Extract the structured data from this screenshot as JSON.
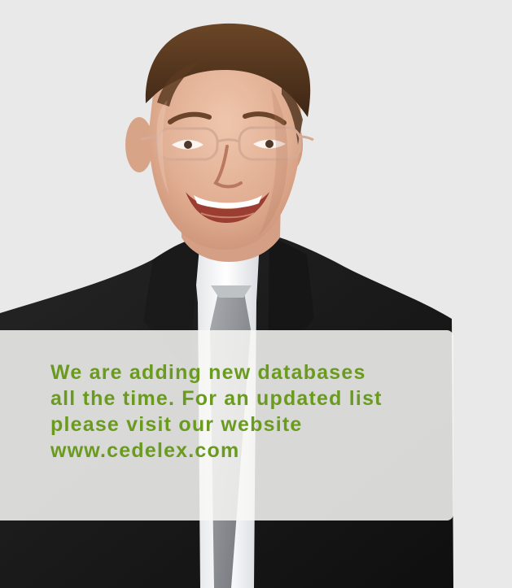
{
  "message": {
    "text": "We are adding new databases\nall the time. For an updated list\nplease visit our website\nwww.cedelex.com"
  },
  "colors": {
    "page_background": "#e9e9e9",
    "message_text": "#6a9b1f",
    "overlay_panel": "#f8f8f6",
    "suit": "#111111"
  },
  "icons": {
    "portrait": "man-portrait-photo"
  }
}
